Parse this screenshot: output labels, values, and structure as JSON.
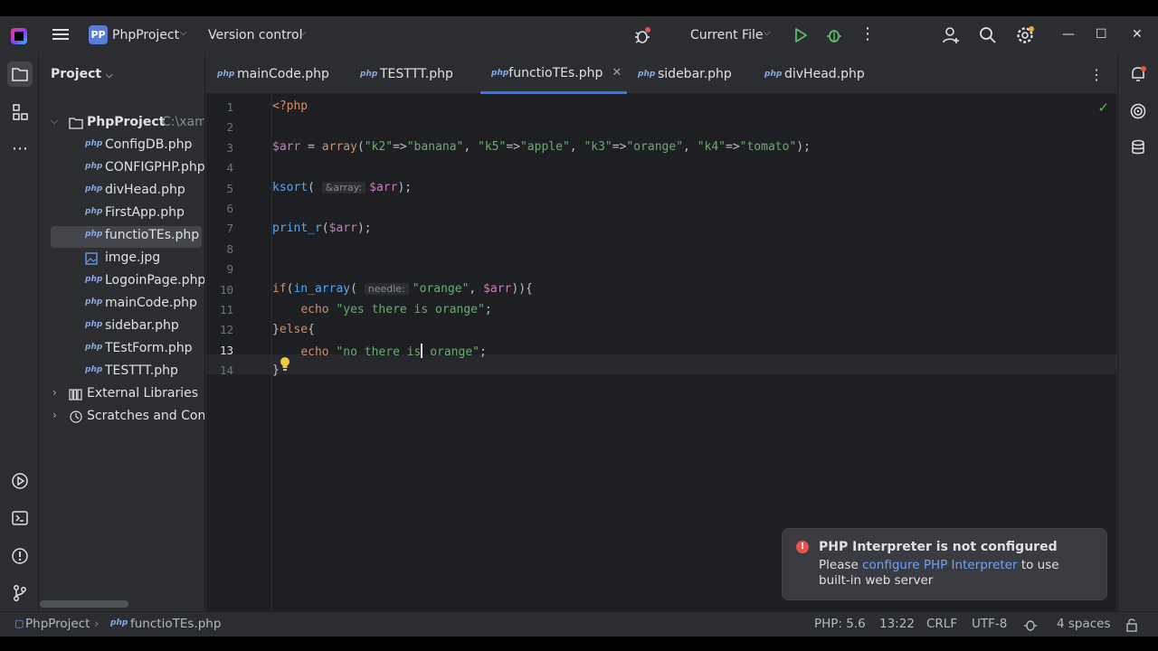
{
  "titlebar": {
    "project_badge": "PP",
    "project_name": "PhpProject",
    "version_control": "Version control",
    "run_config": "Current File",
    "more": "⋮"
  },
  "project_panel": {
    "title": "Project",
    "root": {
      "name": "PhpProject",
      "path": "C:\\xamp"
    },
    "files": [
      "ConfigDB.php",
      "CONFIGPHP.php",
      "divHead.php",
      "FirstApp.php",
      "functioTEs.php",
      "imge.jpg",
      "LogoinPage.php",
      "mainCode.php",
      "sidebar.php",
      "TEstForm.php",
      "TESTTT.php"
    ],
    "external_libraries": "External Libraries",
    "scratches": "Scratches and Cons"
  },
  "tabs": [
    {
      "label": "mainCode.php"
    },
    {
      "label": "TESTTT.php"
    },
    {
      "label": "functioTEs.php",
      "active": true
    },
    {
      "label": "sidebar.php"
    },
    {
      "label": "divHead.php"
    }
  ],
  "php_icon_text": "php",
  "editor": {
    "line_numbers": [
      "1",
      "2",
      "3",
      "4",
      "5",
      "6",
      "7",
      "8",
      "9",
      "10",
      "11",
      "12",
      "13",
      "14"
    ],
    "current_line": "13",
    "lines": {
      "l1": "<?php",
      "l3_var": "$arr",
      "l3_eq": " = ",
      "l3_fn": "array",
      "l3_open": "(",
      "l3_s1": "\"k2\"",
      "l3_a1": "=>",
      "l3_s2": "\"banana\"",
      "l3_c1": ", ",
      "l3_s3": "\"k5\"",
      "l3_a2": "=>",
      "l3_s4": "\"apple\"",
      "l3_c2": ", ",
      "l3_s5": "\"k3\"",
      "l3_a3": "=>",
      "l3_s6": "\"orange\"",
      "l3_c3": ", ",
      "l3_s7": "\"k4\"",
      "l3_a4": "=>",
      "l3_s8": "\"tomato\"",
      "l3_close": ");",
      "l5_fn": "ksort",
      "l5_open": "( ",
      "l5_hint": "&array:",
      "l5_var": "$arr",
      "l5_close": ");",
      "l7_fn": "print_r",
      "l7_open": "(",
      "l7_var": "$arr",
      "l7_close": ");",
      "l10_kw": "if",
      "l10_open": "(",
      "l10_fn": "in_array",
      "l10_open2": "( ",
      "l10_hint": "needle:",
      "l10_str": "\"orange\"",
      "l10_comma": ", ",
      "l10_var": "$arr",
      "l10_close": ")){",
      "l11_kw": "echo",
      "l11_str": "\"yes there is orange\"",
      "l11_end": ";",
      "l12_brace": "}",
      "l12_kw": "else",
      "l12_open": "{",
      "l13_kw": "echo",
      "l13_str_a": "\"no there is",
      "l13_str_b": " orange\"",
      "l13_end": ";",
      "l14": "}"
    }
  },
  "notification": {
    "title": "PHP Interpreter is not configured",
    "prefix": "Please ",
    "link": "configure PHP Interpreter",
    "suffix": " to use built-in web server"
  },
  "statusbar": {
    "breadcrumb_project": "PhpProject",
    "breadcrumb_file": "functioTEs.php",
    "php_version": "PHP: 5.6",
    "position": "13:22",
    "line_sep": "CRLF",
    "encoding": "UTF-8",
    "indent": "4 spaces"
  },
  "colors": {
    "accent": "#3574f0",
    "editor_bg": "#1e1f22",
    "panel_bg": "#2b2d30",
    "keyword": "#cf8e6d",
    "string": "#6aab73",
    "variable": "#c77dbb",
    "function": "#56a8f5",
    "error": "#e5534b"
  }
}
